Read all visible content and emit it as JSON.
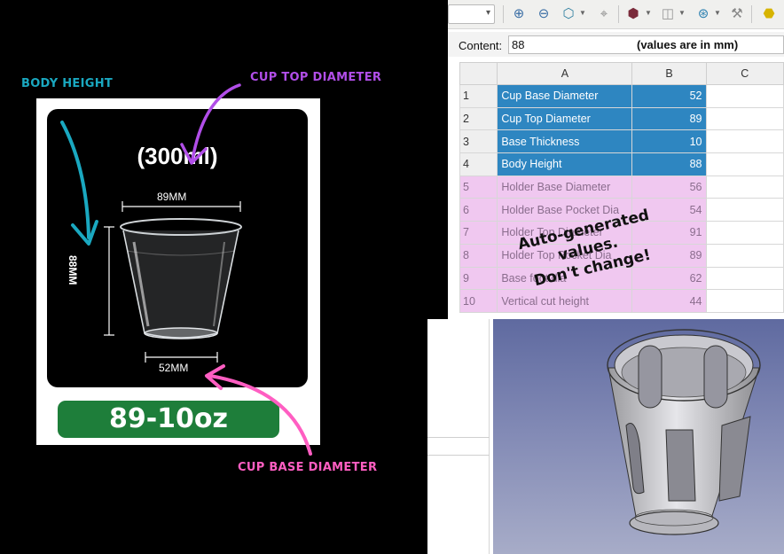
{
  "infographic": {
    "callout_body_height": "BODY HEIGHT",
    "callout_cup_top": "CUP TOP DIAMETER",
    "callout_cup_base": "CUP BASE DIAMETER",
    "capacity_label": "(300ml)",
    "top_dimension": "89MM",
    "height_dimension": "88MM",
    "base_dimension": "52MM",
    "size_badge": "89-10oz",
    "colors": {
      "body": "#1aa8c0",
      "top": "#b14ee8",
      "base": "#ff5ec2",
      "badge": "#1e7e3a"
    }
  },
  "spreadsheet": {
    "content_label": "Content:",
    "content_value": "88",
    "units_note": "(values are in mm)",
    "columns": [
      "A",
      "B",
      "C"
    ],
    "rows": [
      {
        "num": "1",
        "name": "Cup Base Diameter",
        "value": "52"
      },
      {
        "num": "2",
        "name": "Cup Top Diameter",
        "value": "89"
      },
      {
        "num": "3",
        "name": "Base Thickness",
        "value": "10"
      },
      {
        "num": "4",
        "name": "Body Height",
        "value": "88"
      },
      {
        "num": "5",
        "name": "Holder Base Diameter",
        "value": "56"
      },
      {
        "num": "6",
        "name": "Holder Base Pocket Dia",
        "value": "54"
      },
      {
        "num": "7",
        "name": "Holder Top Diameter",
        "value": "91"
      },
      {
        "num": "8",
        "name": "Holder Top Pocket Dia",
        "value": "89"
      },
      {
        "num": "9",
        "name": "Base foot dia",
        "value": "62"
      },
      {
        "num": "10",
        "name": "Vertical cut height",
        "value": "44"
      }
    ],
    "auto_note_line1": "Auto-generated",
    "auto_note_line2": "values.",
    "auto_note_line3": "Don't change!",
    "colors": {
      "selected": "#2e86c1",
      "auto": "#f0c8f0"
    }
  },
  "toolbar": {
    "icons": [
      "zoom-in-icon",
      "zoom-out-icon",
      "view-cube-icon",
      "measure-icon",
      "bounding-box-icon",
      "wireframe-cube-icon",
      "zoom-select-icon",
      "wrench-icon",
      "part-icon"
    ]
  }
}
